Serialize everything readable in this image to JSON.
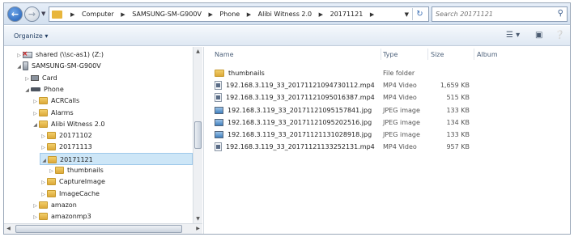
{
  "address": {
    "crumbs": [
      "Computer",
      "SAMSUNG-SM-G900V",
      "Phone",
      "Alibi Witness 2.0",
      "20171121"
    ]
  },
  "search": {
    "placeholder": "Search 20171121"
  },
  "toolbar": {
    "organize_label": "Organize ▾"
  },
  "nav": {
    "items": [
      {
        "label": "shared (\\\\sc-as1) (Z:)",
        "icon": "network-drive-icon",
        "depth": 0,
        "toggle": "▷"
      },
      {
        "label": "SAMSUNG-SM-G900V",
        "icon": "phone-icon",
        "depth": 0,
        "toggle": "◢"
      },
      {
        "label": "Card",
        "icon": "card-icon",
        "depth": 1,
        "toggle": "▷"
      },
      {
        "label": "Phone",
        "icon": "storage-icon",
        "depth": 1,
        "toggle": "◢"
      },
      {
        "label": "ACRCalls",
        "icon": "folder-icon",
        "depth": 2,
        "toggle": "▷"
      },
      {
        "label": "Alarms",
        "icon": "folder-icon",
        "depth": 2,
        "toggle": "▷"
      },
      {
        "label": "Alibi Witness 2.0",
        "icon": "folder-icon",
        "depth": 2,
        "toggle": "◢"
      },
      {
        "label": "20171102",
        "icon": "folder-icon",
        "depth": 3,
        "toggle": "▷"
      },
      {
        "label": "20171113",
        "icon": "folder-icon",
        "depth": 3,
        "toggle": "▷"
      },
      {
        "label": "20171121",
        "icon": "folder-icon",
        "depth": 3,
        "toggle": "◢",
        "selected": true
      },
      {
        "label": "thumbnails",
        "icon": "folder-icon",
        "depth": 4,
        "toggle": "▷"
      },
      {
        "label": "CaptureImage",
        "icon": "folder-icon",
        "depth": 3,
        "toggle": "▷"
      },
      {
        "label": "ImageCache",
        "icon": "folder-icon",
        "depth": 3,
        "toggle": "▷"
      },
      {
        "label": "amazon",
        "icon": "folder-icon",
        "depth": 2,
        "toggle": "▷"
      },
      {
        "label": "amazonmp3",
        "icon": "folder-icon",
        "depth": 2,
        "toggle": "▷"
      }
    ]
  },
  "columns": {
    "name": "Name",
    "type": "Type",
    "size": "Size",
    "album": "Album"
  },
  "files": [
    {
      "name": "thumbnails",
      "type": "File folder",
      "size": "",
      "icon": "folder-icon"
    },
    {
      "name": "192.168.3.119_33_20171121094730112.mp4",
      "type": "MP4 Video",
      "size": "1,659 KB",
      "icon": "video-file-icon"
    },
    {
      "name": "192.168.3.119_33_20171121095016387.mp4",
      "type": "MP4 Video",
      "size": "515 KB",
      "icon": "video-file-icon"
    },
    {
      "name": "192.168.3.119_33_20171121095157841.jpg",
      "type": "JPEG image",
      "size": "133 KB",
      "icon": "image-file-icon"
    },
    {
      "name": "192.168.3.119_33_20171121095202516.jpg",
      "type": "JPEG image",
      "size": "134 KB",
      "icon": "image-file-icon"
    },
    {
      "name": "192.168.3.119_33_20171121131028918.jpg",
      "type": "JPEG image",
      "size": "133 KB",
      "icon": "image-file-icon"
    },
    {
      "name": "192.168.3.119_33_20171121133252131.mp4",
      "type": "MP4 Video",
      "size": "957 KB",
      "icon": "video-file-icon"
    }
  ]
}
